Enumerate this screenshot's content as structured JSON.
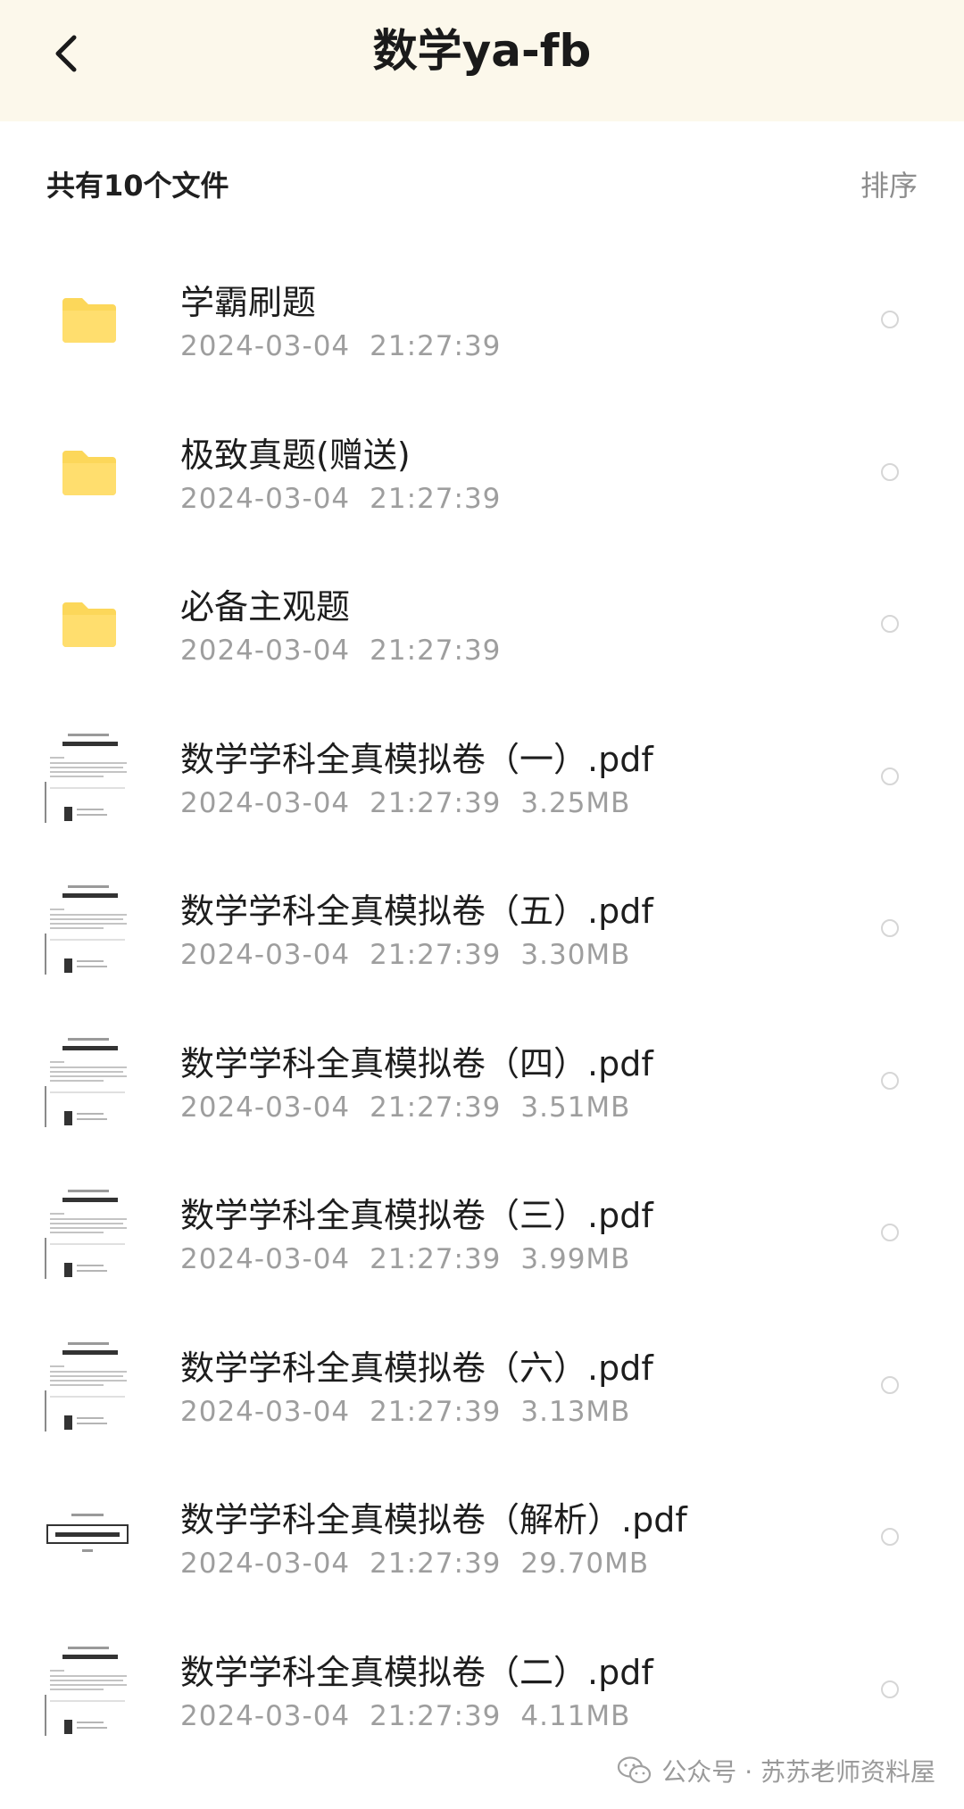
{
  "header": {
    "title": "数学ya-fb",
    "back_icon": "chevron-left-icon"
  },
  "summary": {
    "file_count": "共有10个文件",
    "sort_label": "排序"
  },
  "colors": {
    "header_bg": "#fcf8eb",
    "folder": "#fcd75a",
    "meta_text": "#9e9e9e"
  },
  "files": [
    {
      "type": "folder",
      "name": "学霸刷题",
      "date": "2024-03-04",
      "time": "21:27:39",
      "size": ""
    },
    {
      "type": "folder",
      "name": "极致真题(赠送)",
      "date": "2024-03-04",
      "time": "21:27:39",
      "size": ""
    },
    {
      "type": "folder",
      "name": "必备主观题",
      "date": "2024-03-04",
      "time": "21:27:39",
      "size": ""
    },
    {
      "type": "pdf",
      "name": "数学学科全真模拟卷（一）.pdf",
      "date": "2024-03-04",
      "time": "21:27:39",
      "size": "3.25MB"
    },
    {
      "type": "pdf",
      "name": "数学学科全真模拟卷（五）.pdf",
      "date": "2024-03-04",
      "time": "21:27:39",
      "size": "3.30MB"
    },
    {
      "type": "pdf",
      "name": "数学学科全真模拟卷（四）.pdf",
      "date": "2024-03-04",
      "time": "21:27:39",
      "size": "3.51MB"
    },
    {
      "type": "pdf",
      "name": "数学学科全真模拟卷（三）.pdf",
      "date": "2024-03-04",
      "time": "21:27:39",
      "size": "3.99MB"
    },
    {
      "type": "pdf",
      "name": "数学学科全真模拟卷（六）.pdf",
      "date": "2024-03-04",
      "time": "21:27:39",
      "size": "3.13MB"
    },
    {
      "type": "pdf-cover",
      "name": "数学学科全真模拟卷（解析）.pdf",
      "date": "2024-03-04",
      "time": "21:27:39",
      "size": "29.70MB"
    },
    {
      "type": "pdf",
      "name": "数学学科全真模拟卷（二）.pdf",
      "date": "2024-03-04",
      "time": "21:27:39",
      "size": "4.11MB"
    }
  ],
  "watermark": {
    "text": "公众号 · 苏苏老师资料屋",
    "icon": "wechat-icon"
  }
}
